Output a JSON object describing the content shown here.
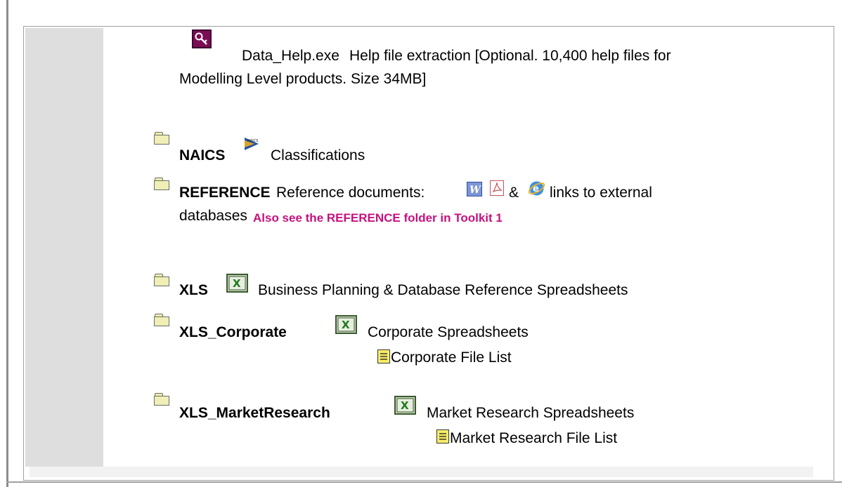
{
  "data_help": {
    "filename": "Data_Help.exe",
    "description_line1": "Help file extraction [Optional. 10,400 help files for",
    "description_line2": "Modelling Level products. Size 34MB]"
  },
  "naics": {
    "folder_label": "NAICS",
    "description": "Classifications"
  },
  "reference": {
    "folder_label": "REFERENCE",
    "description_prefix": "Reference documents:",
    "ampersand": "&",
    "description_suffix": "links to external",
    "line2": "databases",
    "note": "Also see the REFERENCE folder in Toolkit 1"
  },
  "xls": {
    "folder_label": "XLS",
    "description": "Business Planning & Database Reference Spreadsheets"
  },
  "xls_corporate": {
    "folder_label": "XLS_Corporate",
    "description": "Corporate Spreadsheets",
    "file_list_label": "Corporate File List"
  },
  "xls_marketresearch": {
    "folder_label": "XLS_MarketResearch",
    "description": "Market Research Spreadsheets",
    "file_list_label": "Market Research File List"
  },
  "icons": {
    "folder": "folder-icon",
    "excel": "excel-icon",
    "word": "word-icon",
    "pdf": "pdf-icon",
    "ie": "internet-explorer-icon",
    "notepad": "text-file-icon",
    "key": "key-icon",
    "naics": "naics-logo-icon"
  },
  "colors": {
    "note_pink": "#c5127e",
    "gutter_gray": "#dedede"
  }
}
